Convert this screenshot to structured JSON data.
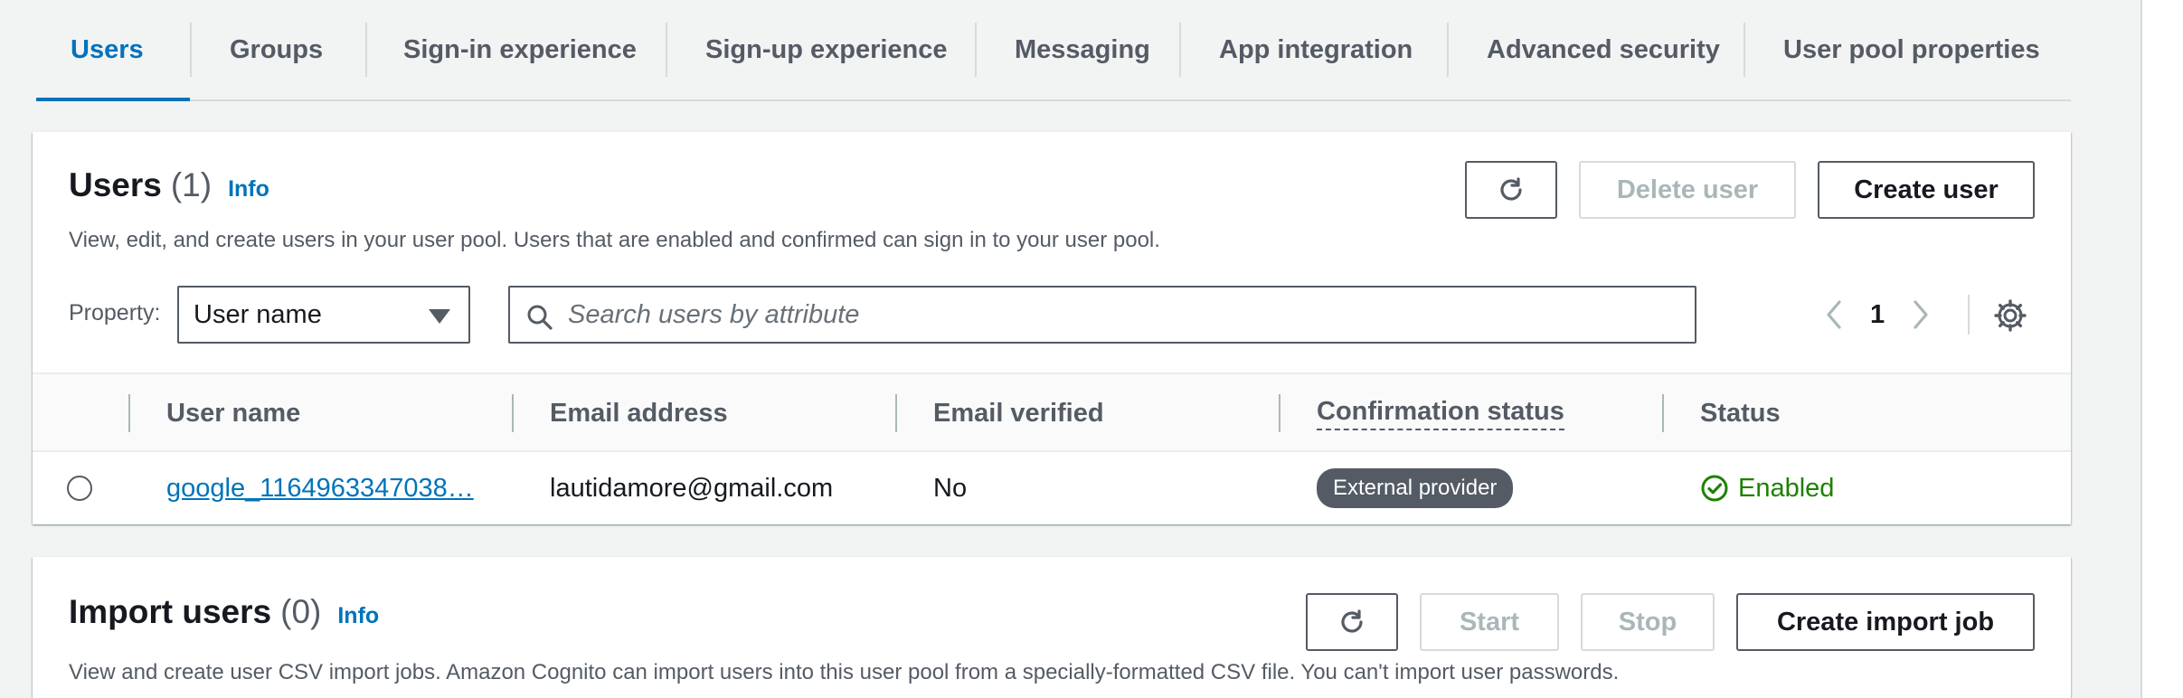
{
  "tabs": [
    {
      "label": "Users"
    },
    {
      "label": "Groups"
    },
    {
      "label": "Sign-in experience"
    },
    {
      "label": "Sign-up experience"
    },
    {
      "label": "Messaging"
    },
    {
      "label": "App integration"
    },
    {
      "label": "Advanced security"
    },
    {
      "label": "User pool properties"
    }
  ],
  "users": {
    "title": "Users",
    "count": "(1)",
    "info": "Info",
    "description": "View, edit, and create users in your user pool. Users that are enabled and confirmed can sign in to your user pool.",
    "delete_label": "Delete user",
    "create_label": "Create user",
    "property_label": "Property:",
    "property_value": "User name",
    "search_placeholder": "Search users by attribute",
    "page": "1",
    "columns": [
      "User name",
      "Email address",
      "Email verified",
      "Confirmation status",
      "Status"
    ],
    "rows": [
      {
        "username": "google_1164963347038…",
        "email": "lautidamore@gmail.com",
        "email_verified": "No",
        "confirmation": "External provider",
        "status": "Enabled"
      }
    ]
  },
  "import": {
    "title": "Import users",
    "count": "(0)",
    "info": "Info",
    "start_label": "Start",
    "stop_label": "Stop",
    "create_label": "Create import job",
    "description": "View and create user CSV import jobs. Amazon Cognito can import users into this user pool from a specially-formatted CSV file. You can't import user passwords."
  },
  "colors": {
    "accent": "#0073bb",
    "success": "#1d8102",
    "badge": "#545b64"
  }
}
